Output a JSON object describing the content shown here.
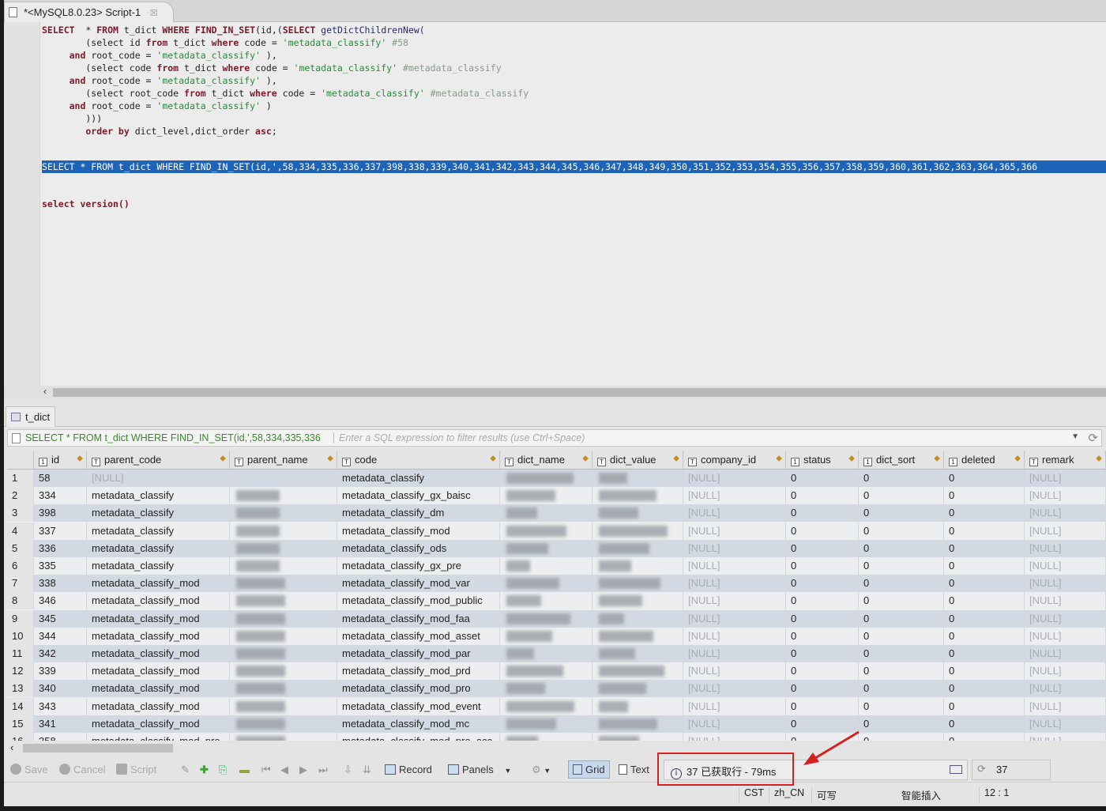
{
  "editor_tab": {
    "title": "*<MySQL8.0.23> Script-1",
    "close": "☒"
  },
  "sql_lines": [
    [
      [
        "kw",
        "SELECT"
      ],
      [
        "",
        "  * "
      ],
      [
        "kw",
        "FROM"
      ],
      [
        "",
        " t_dict "
      ],
      [
        "kw",
        "WHERE"
      ],
      [
        "",
        " "
      ],
      [
        "kw",
        "FIND_IN_SET"
      ],
      [
        "",
        "(id,("
      ],
      [
        "kw",
        "SELECT"
      ],
      [
        "fn",
        " getDictChildrenNew("
      ]
    ],
    [
      [
        "",
        "        (select id "
      ],
      [
        "kw",
        "from"
      ],
      [
        "",
        " t_dict "
      ],
      [
        "kw",
        "where"
      ],
      [
        "",
        " code = "
      ],
      [
        "str",
        "'metadata_classify'"
      ],
      [
        "cm",
        " #58"
      ]
    ],
    [
      [
        "kw",
        "     and"
      ],
      [
        "",
        " root_code = "
      ],
      [
        "str",
        "'metadata_classify'"
      ],
      [
        "",
        " ),"
      ]
    ],
    [
      [
        "",
        "        (select code "
      ],
      [
        "kw",
        "from"
      ],
      [
        "",
        " t_dict "
      ],
      [
        "kw",
        "where"
      ],
      [
        "",
        " code = "
      ],
      [
        "str",
        "'metadata_classify'"
      ],
      [
        "cm",
        " #metadata_classify"
      ]
    ],
    [
      [
        "kw",
        "     and"
      ],
      [
        "",
        " root_code = "
      ],
      [
        "str",
        "'metadata_classify'"
      ],
      [
        "",
        " ),"
      ]
    ],
    [
      [
        "",
        "        (select root_code "
      ],
      [
        "kw",
        "from"
      ],
      [
        "",
        " t_dict "
      ],
      [
        "kw",
        "where"
      ],
      [
        "",
        " code = "
      ],
      [
        "str",
        "'metadata_classify'"
      ],
      [
        "cm",
        " #metadata_classify"
      ]
    ],
    [
      [
        "kw",
        "     and"
      ],
      [
        "",
        " root_code = "
      ],
      [
        "str",
        "'metadata_classify'"
      ],
      [
        "",
        " )"
      ]
    ],
    [
      [
        "",
        "        )))"
      ]
    ],
    [
      [
        "kw",
        "        order by"
      ],
      [
        "",
        " dict_level,dict_order "
      ],
      [
        "kw",
        "asc"
      ],
      [
        "",
        ";"
      ]
    ]
  ],
  "selected_line": "SELECT * FROM t_dict WHERE FIND_IN_SET(id,',58,334,335,336,337,398,338,339,340,341,342,343,344,345,346,347,348,349,350,351,352,353,354,355,356,357,358,359,360,361,362,363,364,365,366",
  "version_line": "select version()",
  "results_tab": "t_dict",
  "filter": {
    "query": "SELECT * FROM t_dict WHERE FIND_IN_SET(id,',58,334,335,336",
    "placeholder": "Enter a SQL expression to filter results (use Ctrl+Space)"
  },
  "columns": [
    "id",
    "parent_code",
    "parent_name",
    "code",
    "dict_name",
    "dict_value",
    "company_id",
    "status",
    "dict_sort",
    "deleted",
    "remark"
  ],
  "rows": [
    [
      "58",
      "[NULL]",
      "metadata_classify"
    ],
    [
      "334",
      "metadata_classify",
      "metadata_classify_gx_baisc"
    ],
    [
      "398",
      "metadata_classify",
      "metadata_classify_dm"
    ],
    [
      "337",
      "metadata_classify",
      "metadata_classify_mod"
    ],
    [
      "336",
      "metadata_classify",
      "metadata_classify_ods"
    ],
    [
      "335",
      "metadata_classify",
      "metadata_classify_gx_pre"
    ],
    [
      "338",
      "metadata_classify_mod",
      "metadata_classify_mod_var"
    ],
    [
      "346",
      "metadata_classify_mod",
      "metadata_classify_mod_public"
    ],
    [
      "345",
      "metadata_classify_mod",
      "metadata_classify_mod_faa"
    ],
    [
      "344",
      "metadata_classify_mod",
      "metadata_classify_mod_asset"
    ],
    [
      "342",
      "metadata_classify_mod",
      "metadata_classify_mod_par"
    ],
    [
      "339",
      "metadata_classify_mod",
      "metadata_classify_mod_prd"
    ],
    [
      "340",
      "metadata_classify_mod",
      "metadata_classify_mod_pro"
    ],
    [
      "343",
      "metadata_classify_mod",
      "metadata_classify_mod_event"
    ],
    [
      "341",
      "metadata_classify_mod",
      "metadata_classify_mod_mc"
    ],
    [
      "358",
      "metadata_classify_mod_pro",
      "metadata_classify_mod_pro_acc"
    ]
  ],
  "null_text": "[NULL]",
  "zero": "0",
  "toolbar": {
    "save": "Save",
    "cancel": "Cancel",
    "script": "Script",
    "record": "Record",
    "panels": "Panels",
    "grid": "Grid",
    "text": "Text"
  },
  "status_info": "37 已获取行 - 79ms",
  "row_count": "37",
  "statusbar": {
    "tz": "CST",
    "locale": "zh_CN",
    "mode": "可写",
    "insert": "智能插入",
    "pos": "12 : 1"
  },
  "colors": {
    "selection": "#1d63b8",
    "highlight_box": "#d42020",
    "keyword": "#7a1a2a",
    "string": "#2a8a3a"
  }
}
